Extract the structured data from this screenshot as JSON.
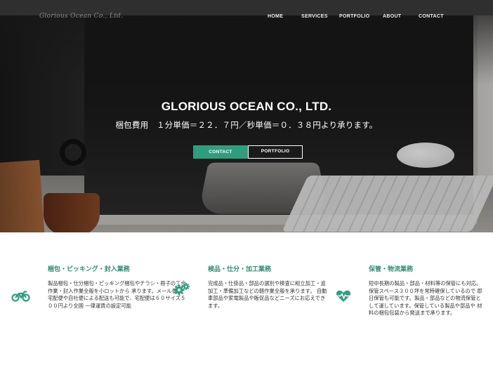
{
  "brand": {
    "logo_text": "Glorious Ocean Co., Ltd.",
    "accent_color": "#2f9e80"
  },
  "nav": {
    "items": [
      {
        "label": "HOME"
      },
      {
        "label": "SERVICES"
      },
      {
        "label": "PORTFOLIO"
      },
      {
        "label": "ABOUT"
      },
      {
        "label": "CONTACT"
      }
    ]
  },
  "hero": {
    "title": "GLORIOUS OCEAN CO., LTD.",
    "subtitle": "梱包費用　１分単価＝２２．７円／秒単価＝０．３８円より承ります。",
    "buttons": {
      "contact": "CONTACT",
      "portfolio": "PORTFOLIO"
    }
  },
  "services": [
    {
      "icon": "motorcycle-icon",
      "title": "梱包・ピッキング・封入業務",
      "text": "製品梱包・仕分梱包・ピッキング梱包やチラシ・冊子の丁合作業・封入作業全般を小ロットから 承ります。メール便や宅配便や自社便による配送も可能で、宅配便は６０サイズ５００円より全国 一律運賃の設定可能"
    },
    {
      "icon": "gears-icon",
      "title": "検品・仕分・加工業務",
      "text": "完成品・仕掛品・部品の選別や検査に組立加工・追加工・準備加工などの軽作業全般を承ります。 自動車部品や家電製品や販促品などニーズにお応えできます。"
    },
    {
      "icon": "heartbeat-icon",
      "title": "保管・物流業務",
      "text": "短中長期の製品・部品・材料等の保管にも対応。保管スペース３００坪を常時確保しているので 即日保管も可能です。製品・部品などの物流保管として運しています。保管している製品や部品や 材料の梱包包装から発送まで承ります。"
    }
  ]
}
